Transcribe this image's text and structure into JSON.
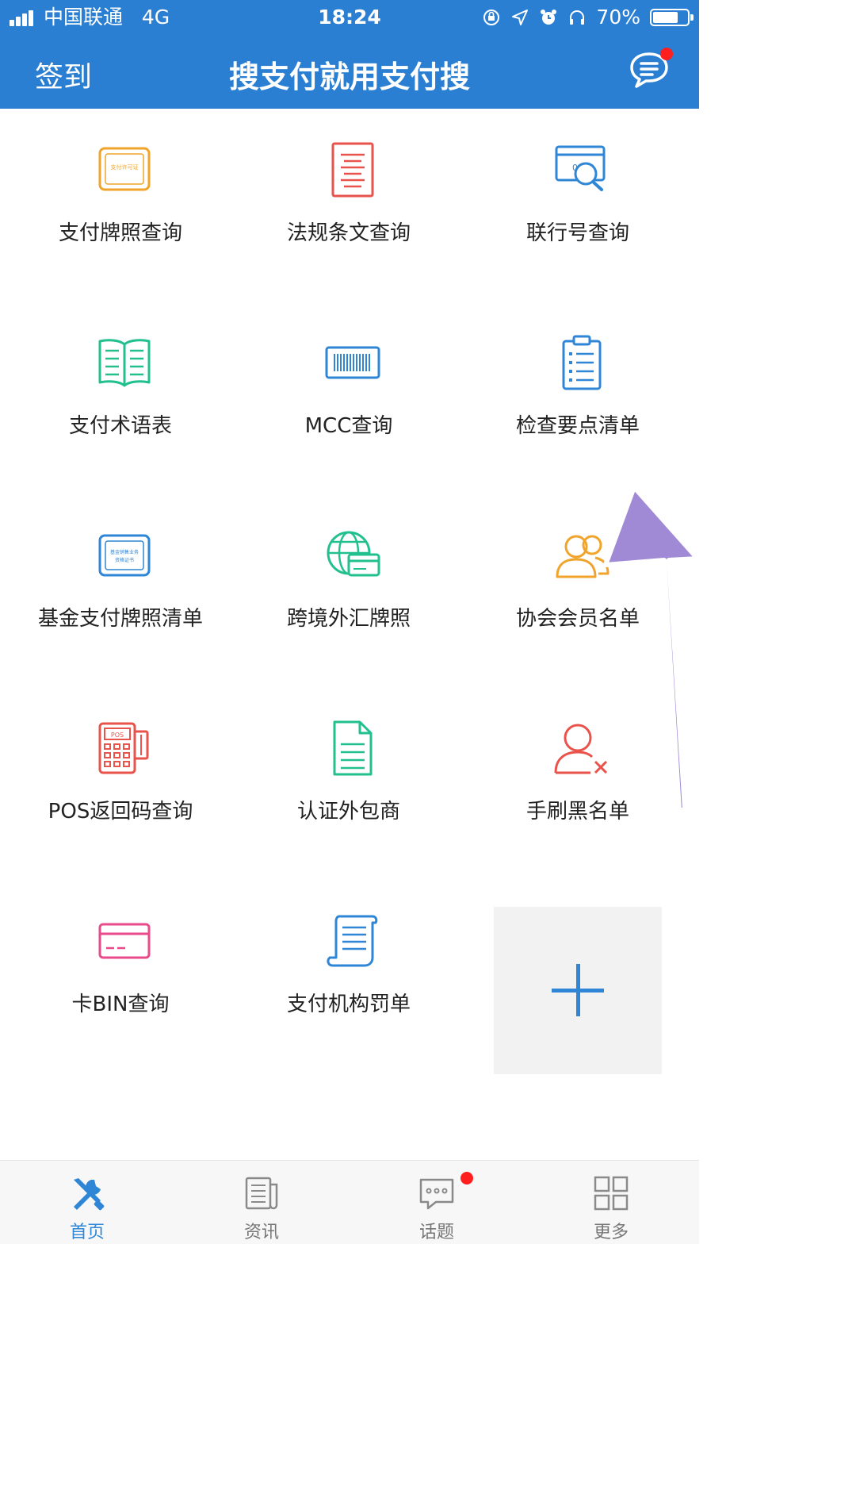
{
  "status_bar": {
    "carrier": "中国联通",
    "network": "4G",
    "time": "18:24",
    "battery_percent": "70%",
    "battery_level": 0.7
  },
  "nav": {
    "left_label": "签到",
    "title": "搜支付就用支付搜",
    "chat_icon": "chat-bubble-icon",
    "has_notification": true
  },
  "grid": {
    "items": [
      {
        "label": "支付牌照查询",
        "icon": "payment-license-icon",
        "color": "#f0a42b"
      },
      {
        "label": "法规条文查询",
        "icon": "regulation-document-icon",
        "color": "#e8534b"
      },
      {
        "label": "联行号查询",
        "icon": "bank-card-search-icon",
        "color": "#2f86d6"
      },
      {
        "label": "支付术语表",
        "icon": "open-book-icon",
        "color": "#22c08e"
      },
      {
        "label": "MCC查询",
        "icon": "barcode-icon",
        "color": "#2f86d6"
      },
      {
        "label": "检查要点清单",
        "icon": "clipboard-checklist-icon",
        "color": "#2f86d6"
      },
      {
        "label": "基金支付牌照清单",
        "icon": "fund-certificate-icon",
        "color": "#2f86d6"
      },
      {
        "label": "跨境外汇牌照",
        "icon": "globe-card-icon",
        "color": "#22c08e"
      },
      {
        "label": "协会会员名单",
        "icon": "members-group-icon",
        "color": "#f0a42b"
      },
      {
        "label": "POS返回码查询",
        "icon": "pos-terminal-icon",
        "color": "#e8534b"
      },
      {
        "label": "认证外包商",
        "icon": "document-icon",
        "color": "#22c08e"
      },
      {
        "label": "手刷黑名单",
        "icon": "user-blacklist-icon",
        "color": "#e8534b"
      },
      {
        "label": "卡BIN查询",
        "icon": "bank-card-icon",
        "color": "#e84a8a"
      },
      {
        "label": "支付机构罚单",
        "icon": "scroll-list-icon",
        "color": "#2f86d6"
      }
    ],
    "add_button_icon": "plus-icon"
  },
  "tabbar": {
    "tabs": [
      {
        "label": "首页",
        "icon": "tools-icon",
        "active": true
      },
      {
        "label": "资讯",
        "icon": "newspaper-icon",
        "active": false
      },
      {
        "label": "话题",
        "icon": "chat-dots-icon",
        "active": false,
        "badge": true
      },
      {
        "label": "更多",
        "icon": "grid-icon",
        "active": false
      }
    ]
  },
  "colors": {
    "header_bg": "#2a7fd2",
    "accent": "#2f86d6",
    "badge": "#ff1f1f",
    "arrow": "#a08ad6"
  }
}
